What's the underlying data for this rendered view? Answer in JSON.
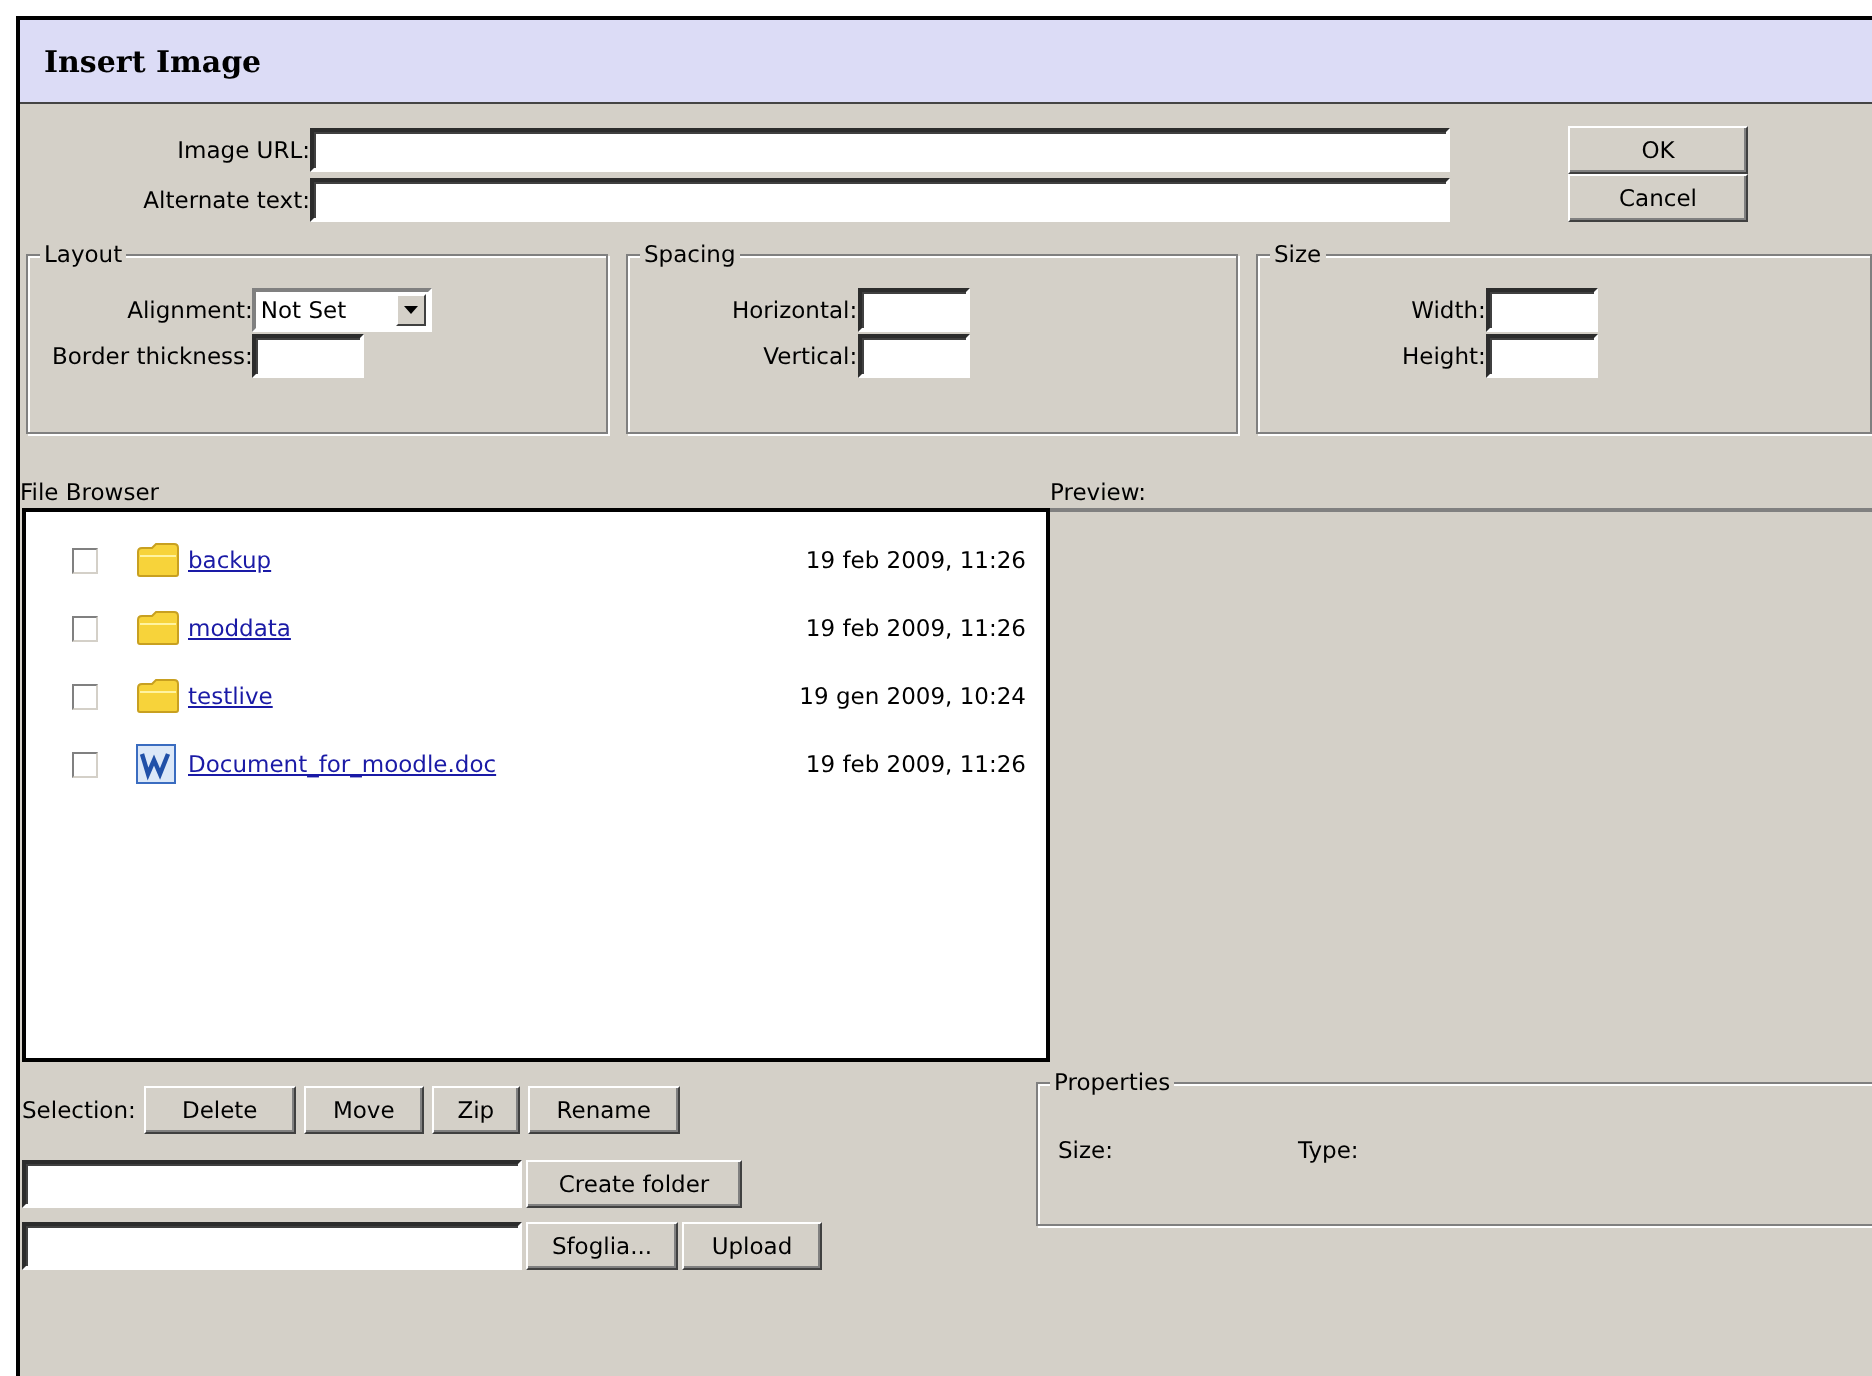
{
  "window": {
    "title": "Insert Image"
  },
  "fields": [
    {
      "label": "Image URL:"
    },
    {
      "label": "Alternate text:"
    }
  ],
  "buttons": [
    "OK",
    "Cancel"
  ],
  "groups": [
    {
      "legend": "Layout",
      "fields": [
        {
          "kind": "select",
          "label": "Alignment:",
          "value": "Not Set"
        },
        {
          "kind": "text",
          "label": "Border thickness:"
        }
      ]
    },
    {
      "legend": "Spacing",
      "fields": [
        {
          "kind": "text",
          "label": "Horizontal:"
        },
        {
          "kind": "text",
          "label": "Vertical:"
        }
      ]
    },
    {
      "legend": "Size",
      "fields": [
        {
          "kind": "text",
          "label": "Width:"
        },
        {
          "kind": "text",
          "label": "Height:"
        }
      ]
    }
  ],
  "file_browser": {
    "label": "File Browser",
    "files": [
      {
        "kind": "folder",
        "name": "backup",
        "date": "19 feb 2009, 11:26",
        "checked": false
      },
      {
        "kind": "folder",
        "name": "moddata",
        "date": "19 feb 2009, 11:26",
        "checked": false
      },
      {
        "kind": "folder",
        "name": "testlive",
        "date": "19 gen 2009, 10:24",
        "checked": false
      },
      {
        "kind": "document",
        "name": "Document_for_moodle.doc",
        "date": "19 feb 2009, 11:26",
        "checked": false
      }
    ]
  },
  "preview": {
    "label": "Preview:"
  },
  "selection": {
    "label": "Selection:",
    "buttons": [
      "Delete",
      "Move",
      "Zip",
      "Rename"
    ]
  },
  "create_folder": {
    "button": "Create folder"
  },
  "upload": {
    "buttons": [
      "Sfoglia...",
      "Upload"
    ]
  },
  "properties": {
    "legend": "Properties",
    "labels": [
      "Size:",
      "Type:"
    ]
  }
}
